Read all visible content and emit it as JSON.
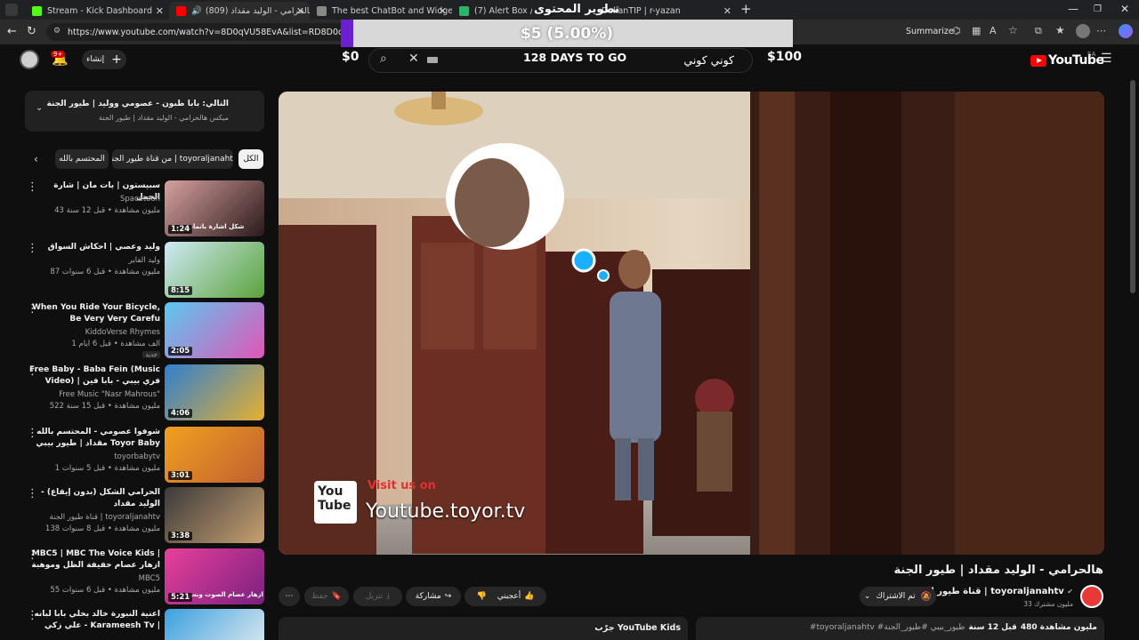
{
  "browser": {
    "tabs": [
      {
        "label": "Stream - Kick Dashboard",
        "color": "#53fc18"
      },
      {
        "label": "هالحرامي - الوليد مقداد (809)",
        "color": "#ff0000"
      },
      {
        "label": "The best ChatBot and Widgets fo",
        "color": "#888888"
      },
      {
        "label": "(7) Alert Box / Stream",
        "color": "#2fb36b"
      },
      {
        "label": "DokanTIP | r-yazan",
        "color": "#5b5b5b"
      }
    ],
    "url": "https://www.youtube.com/watch?v=8D0qVU58EvA&list=RD8D0qVU58EvA",
    "summarize_label": "Summarize"
  },
  "overlay": {
    "goal_text": "$5 (5.00%)",
    "goal_progress": 0.05,
    "goal_start": "$0",
    "goal_end": "$100",
    "goal_title_ar": "تطوير المحتوى",
    "days_text": "128 DAYS TO GO"
  },
  "header": {
    "create_label": "إنشاء",
    "notif_count": "9+",
    "search_value": "كوني كوني",
    "logo": "YouTube",
    "region": "SA"
  },
  "queue": {
    "title": "التالي: بابا ظبون - عصومي ووليد | طيور الجنة",
    "subtitle": "ميكس هالحرامي - الوليد مقداد | طيور الجنة"
  },
  "chips": [
    {
      "label": "الكل"
    },
    {
      "label": "من قناة طيور الجنة | toyoraljanahtv"
    },
    {
      "label": "المحتسم بالله"
    }
  ],
  "videos": [
    {
      "title": "سبيستون | بات مان | شارة الحمل",
      "channel": "Spacetoon",
      "meta": "43 مليون مشاهدة • قبل 12 سنة",
      "duration": "1:24",
      "thumb_caption": "شكل اشارة باتمان",
      "colors": [
        "#d8a0a0",
        "#2a1a1a"
      ]
    },
    {
      "title": "وليد وعصي | احكاش السواق",
      "channel": "وليد الفاير",
      "meta": "87 مليون مشاهدة • قبل 6 سنوات",
      "duration": "8:15",
      "colors": [
        "#cfe9f6",
        "#5aa33a"
      ]
    },
    {
      "title": "When You Ride Your Bicycle, Be Very Very Carefu",
      "channel": "KiddoVerse Rhymes",
      "meta": "1 ألف مشاهدة • قبل 6 أيام",
      "badge": "جديد",
      "duration": "2:05",
      "colors": [
        "#5bc8f0",
        "#e056b8"
      ]
    },
    {
      "title": "Free Baby - Baba Fein (Music Video) | فري بيبي - بابا فين (فيديو كليب)",
      "channel": "Free Music \"Nasr Mahrous\"",
      "meta": "522 مليون مشاهدة • قبل 15 سنة",
      "duration": "4:06",
      "colors": [
        "#2f7fd0",
        "#e6b030"
      ]
    },
    {
      "title": "شوفوا عصومي - المحتسم بالله مقداد | طيور بيبي Toyor Baby",
      "channel": "toyorbabytv",
      "meta": "1 مليون مشاهدة • قبل 5 سنوات",
      "duration": "3:01",
      "colors": [
        "#f0a020",
        "#c06030"
      ]
    },
    {
      "title": "الحرامي الشكل (بدون إيقاع) - الوليد مقداد",
      "channel": "قناة طيور الجنة | toyoraljanahtv",
      "meta": "138 مليون مشاهدة • قبل 8 سنوات",
      "duration": "3:38",
      "colors": [
        "#3a3a3a",
        "#c8a070"
      ]
    },
    {
      "title": "MBC5 | MBC The Voice Kids | ازهار عصام خفيفة الظل وموهبة استثنائية في...",
      "channel": "MBC5",
      "meta": "55 مليون مشاهدة • قبل 6 سنوات",
      "duration": "5:21",
      "thumb_caption": "ازهار عصام الصوت وبس",
      "colors": [
        "#e8409a",
        "#7a2080"
      ]
    },
    {
      "title": "اعنية النبورة خالد بخلي بابا لبانه - علي زكي Karameesh Tv | قناة كراميش",
      "channel": "",
      "meta": "",
      "duration": "",
      "colors": [
        "#3aa0e0",
        "#f0f0f0"
      ]
    }
  ],
  "player": {
    "watermark_line1": "Visit us on",
    "watermark_line2": "Youtube.toyor.tv",
    "watermark_logo": "You Tube"
  },
  "video": {
    "title": "هالحرامي - الوليد مقداد | طيور الجنة",
    "channel": "قناة طيور الجنة | toyoraljanahtv",
    "subs": "33 مليون مشترك",
    "subscribed_label": "تم الاشتراك",
    "like_label": "أعجبني",
    "share_label": "مشاركة",
    "download_label": "تنزيل",
    "save_label": "حفظ",
    "kids_label": "جرّب YouTube Kids",
    "desc_views": "480 مليون مشاهدة",
    "desc_date": "قبل 12 سنة",
    "desc_tags": "#toyoraljanahtv #طيور_بيبي #طيور_الجنة"
  }
}
